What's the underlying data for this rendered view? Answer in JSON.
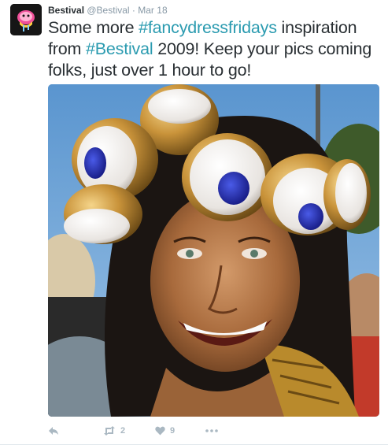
{
  "tweet": {
    "display_name": "Bestival",
    "username": "@Bestival",
    "separator": "·",
    "timestamp": "Mar 18",
    "text": {
      "part1": "Some more ",
      "hashtag1": "#fancydressfridays",
      "part2": " inspiration from ",
      "hashtag2": "#Bestival",
      "part3": " 2009! Keep your pics coming folks, just over 1 hour to go!"
    },
    "actions": {
      "reply_icon": "reply-icon",
      "retweet_icon": "retweet-icon",
      "retweet_count": "2",
      "like_icon": "heart-icon",
      "like_count": "9",
      "more_icon": "more-dots-icon"
    }
  },
  "colors": {
    "hashtag": "#2b9bb0",
    "action_gray": "#aab8c2",
    "meta_gray": "#8899a6",
    "text": "#292f33"
  }
}
